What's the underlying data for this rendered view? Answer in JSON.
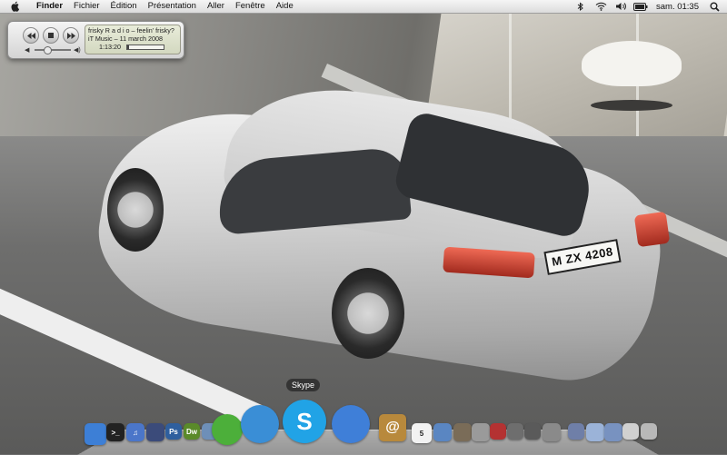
{
  "menubar": {
    "apple_icon": "apple-icon",
    "app_name": "Finder",
    "items": [
      "Fichier",
      "Édition",
      "Présentation",
      "Aller",
      "Fenêtre",
      "Aide"
    ],
    "status_icons": [
      "bluetooth-icon",
      "wifi-icon",
      "volume-icon",
      "battery-icon"
    ],
    "clock": "sam. 01:35",
    "spotlight_icon": "spotlight-icon"
  },
  "player": {
    "prev_icon": "previous-icon",
    "stop_icon": "stop-icon",
    "next_icon": "next-icon",
    "volume_low_icon": "volume-low-icon",
    "volume_high_icon": "volume-high-icon",
    "volume_level": 0.35,
    "track_title": "frisky R a d i o – feelin' frisky?",
    "track_source": "iT Music – 11 march 2008",
    "elapsed": "1:13:20",
    "progress": 0.05
  },
  "wallpaper": {
    "plate_text": "M ZX 4208"
  },
  "dock": {
    "tooltip": "Skype",
    "apps": [
      {
        "name": "finder-icon",
        "label": "",
        "color": "#3d7fd6"
      },
      {
        "name": "terminal-icon",
        "label": ">_",
        "color": "#222222"
      },
      {
        "name": "itunes-icon",
        "label": "♫",
        "color": "#4b76c9"
      },
      {
        "name": "dashboard-icon",
        "label": "",
        "color": "#3b4b7a"
      },
      {
        "name": "photoshop-icon",
        "label": "Ps",
        "color": "#2f5f9e"
      },
      {
        "name": "dreamweaver-icon",
        "label": "Dw",
        "color": "#5a8a2a"
      },
      {
        "name": "preview-icon",
        "label": "",
        "color": "#6e8fb8"
      },
      {
        "name": "adium-icon",
        "label": "",
        "color": "#4caf3a"
      },
      {
        "name": "safari-icon",
        "label": "",
        "color": "#3a8ed6"
      },
      {
        "name": "skype-icon",
        "label": "S",
        "color": "#21a3e6"
      },
      {
        "name": "ichat-icon",
        "label": "",
        "color": "#3f7fd8"
      },
      {
        "name": "address-book-icon",
        "label": "@",
        "color": "#b8893c"
      },
      {
        "name": "ical-icon",
        "label": "5",
        "color": "#f2f2f2"
      },
      {
        "name": "mail-icon",
        "label": "",
        "color": "#5a86c2"
      },
      {
        "name": "photo-icon",
        "label": "",
        "color": "#7a6c58"
      },
      {
        "name": "disk-utility-icon",
        "label": "",
        "color": "#9a9a9a"
      },
      {
        "name": "red-app-icon",
        "label": "",
        "color": "#b43232"
      },
      {
        "name": "compass-icon",
        "label": "",
        "color": "#6e6e6e"
      },
      {
        "name": "activity-monitor-icon",
        "label": "",
        "color": "#5a5a5a"
      },
      {
        "name": "system-preferences-icon",
        "label": "",
        "color": "#8a8a8a"
      },
      {
        "name": "applications-folder-icon",
        "label": "",
        "color": "#6f7fa8"
      },
      {
        "name": "documents-folder-icon",
        "label": "",
        "color": "#9bb3d8"
      },
      {
        "name": "downloads-folder-icon",
        "label": "",
        "color": "#7892c0"
      },
      {
        "name": "stack-icon",
        "label": "",
        "color": "#d0d0d0"
      },
      {
        "name": "trash-icon",
        "label": "",
        "color": "#b8b8b8"
      }
    ]
  }
}
